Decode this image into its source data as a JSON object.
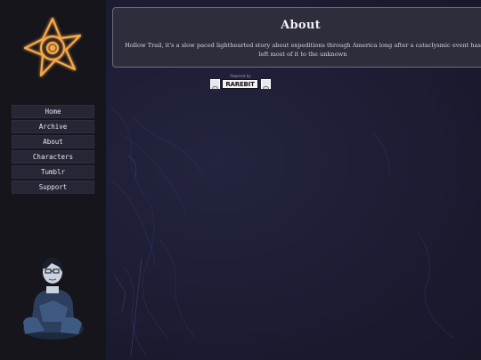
{
  "sidebar": {
    "logo_icon": "glowing-star-sigil-icon",
    "nav": [
      {
        "label": "Home"
      },
      {
        "label": "Archive"
      },
      {
        "label": "About"
      },
      {
        "label": "Characters"
      },
      {
        "label": "Tumblr"
      },
      {
        "label": "Support"
      }
    ],
    "character_icon": "hooded-character-illustration"
  },
  "main": {
    "about": {
      "title": "About",
      "body": "Hollow Trail, it's a slow paced lighthearted story about expeditions through America long after a cataclysmic event has left most of it to the unknown"
    },
    "powered_by": {
      "label": "Powered by",
      "name": "RAREBIT"
    }
  },
  "colors": {
    "accent_glow": "#f0a040",
    "background": "#1b1a2c",
    "sidebar": "#16151c"
  }
}
